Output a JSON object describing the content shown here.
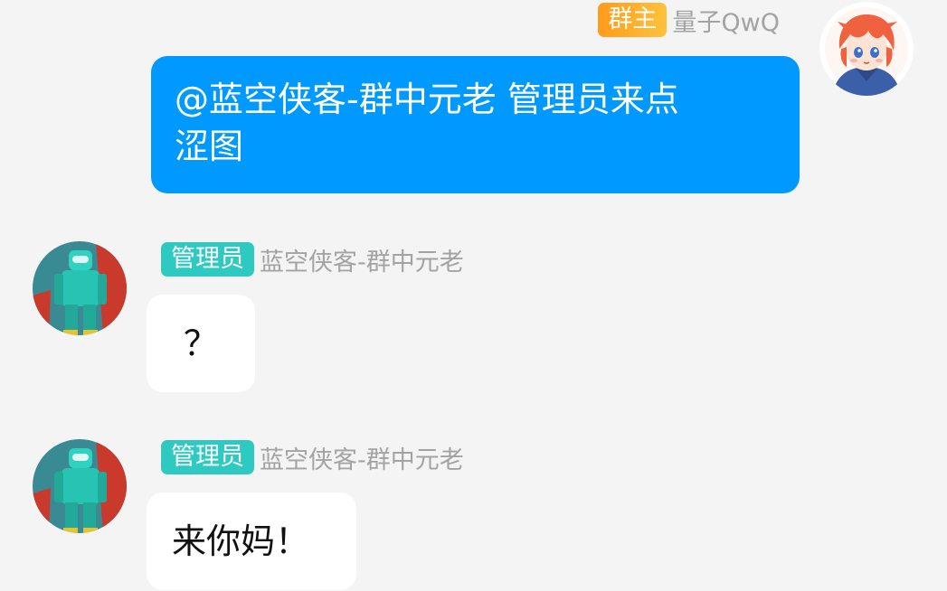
{
  "messages": [
    {
      "badge": "群主",
      "sender": "量子QwQ",
      "text": "@蓝空侠客-群中元老 管理员来点\n涩图"
    },
    {
      "badge": "管理员",
      "sender": "蓝空侠客-群中元老",
      "text": "？"
    },
    {
      "badge": "管理员",
      "sender": "蓝空侠客-群中元老",
      "text": "来你妈！"
    }
  ],
  "colors": {
    "background": "#f4f4f5",
    "self_bubble": "#0099ff",
    "owner_badge": "#ffa826",
    "admin_badge": "#2ec9c0",
    "name_text": "#a3a3a3"
  },
  "icons": {
    "owner_avatar": "anime-character-avatar",
    "admin_avatar": "teal-pixel-figure-avatar"
  }
}
